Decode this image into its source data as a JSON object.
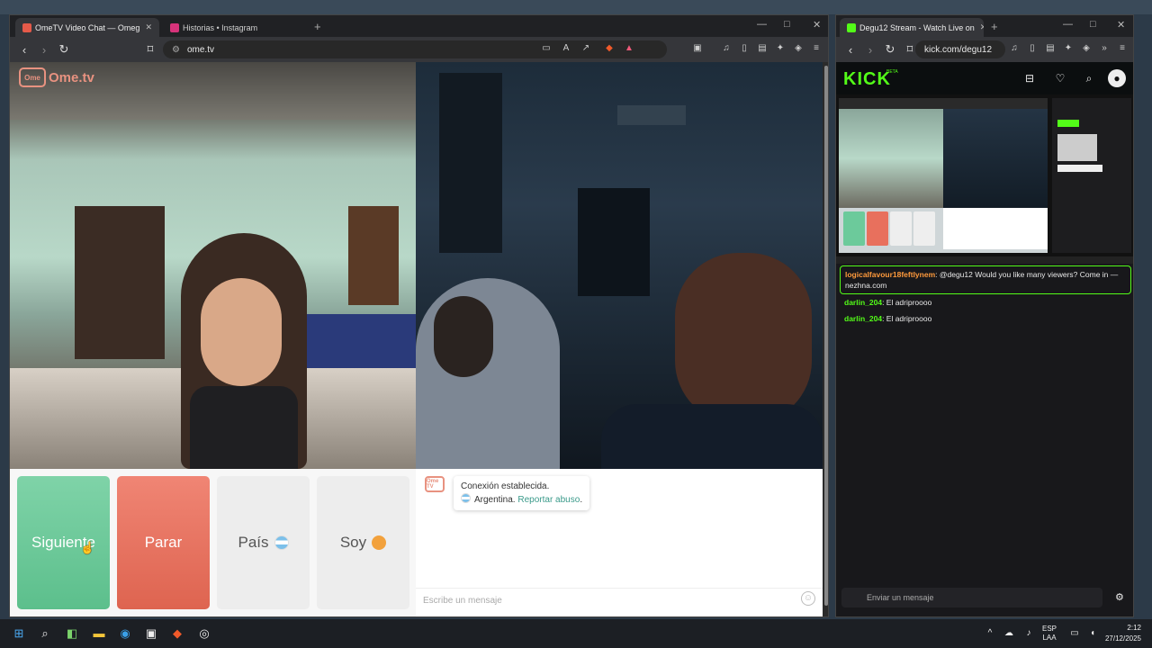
{
  "left_browser": {
    "tabs": [
      {
        "label": "OmeTV Video Chat — Omeg",
        "favicon_color": "#e55a49",
        "active": true
      },
      {
        "label": "Historias • Instagram",
        "favicon_color": "#d6337a",
        "active": false
      }
    ],
    "new_tab": "+",
    "url": "ome.tv",
    "window_controls": [
      "—",
      "□",
      "✕"
    ]
  },
  "ometv": {
    "logo_box": "Ome",
    "logo_text": "Ome.tv",
    "buttons": {
      "next": "Siguiente",
      "stop": "Parar",
      "country": "País",
      "gender": "Soy"
    },
    "system_avatar": "Ome TV",
    "connection_message": "Conexión establecida.",
    "country": "Argentina.",
    "report_link": "Reportar abuso",
    "message_placeholder": "Escribe un mensaje",
    "colors": {
      "next": "#6cca9b",
      "stop": "#e8705d"
    }
  },
  "right_browser": {
    "tab": {
      "label": "Degu12 Stream - Watch Live on",
      "favicon_color": "#53fc18"
    },
    "url": "kick.com/degu12",
    "window_controls": [
      "—",
      "□",
      "✕"
    ]
  },
  "kick": {
    "logo": "KICK",
    "beta": "BETA",
    "chat": [
      {
        "user": "logicalfavour18feftlynem",
        "user_color": "#ff9a3c",
        "text": ": @degu12 Would you like many viewers? Come in — nezhna.com",
        "highlight": true
      },
      {
        "user": "darlin_204",
        "user_color": "#53fc18",
        "text": ": El adriproooo",
        "highlight": false
      },
      {
        "user": "darlin_204",
        "user_color": "#53fc18",
        "text": ": El adriproooo",
        "highlight": false
      }
    ],
    "input_placeholder": "Enviar un mensaje"
  },
  "taskbar": {
    "lang_top": "ESP",
    "lang_bottom": "LAA",
    "time": "2:12",
    "date": "27/12/2025"
  }
}
